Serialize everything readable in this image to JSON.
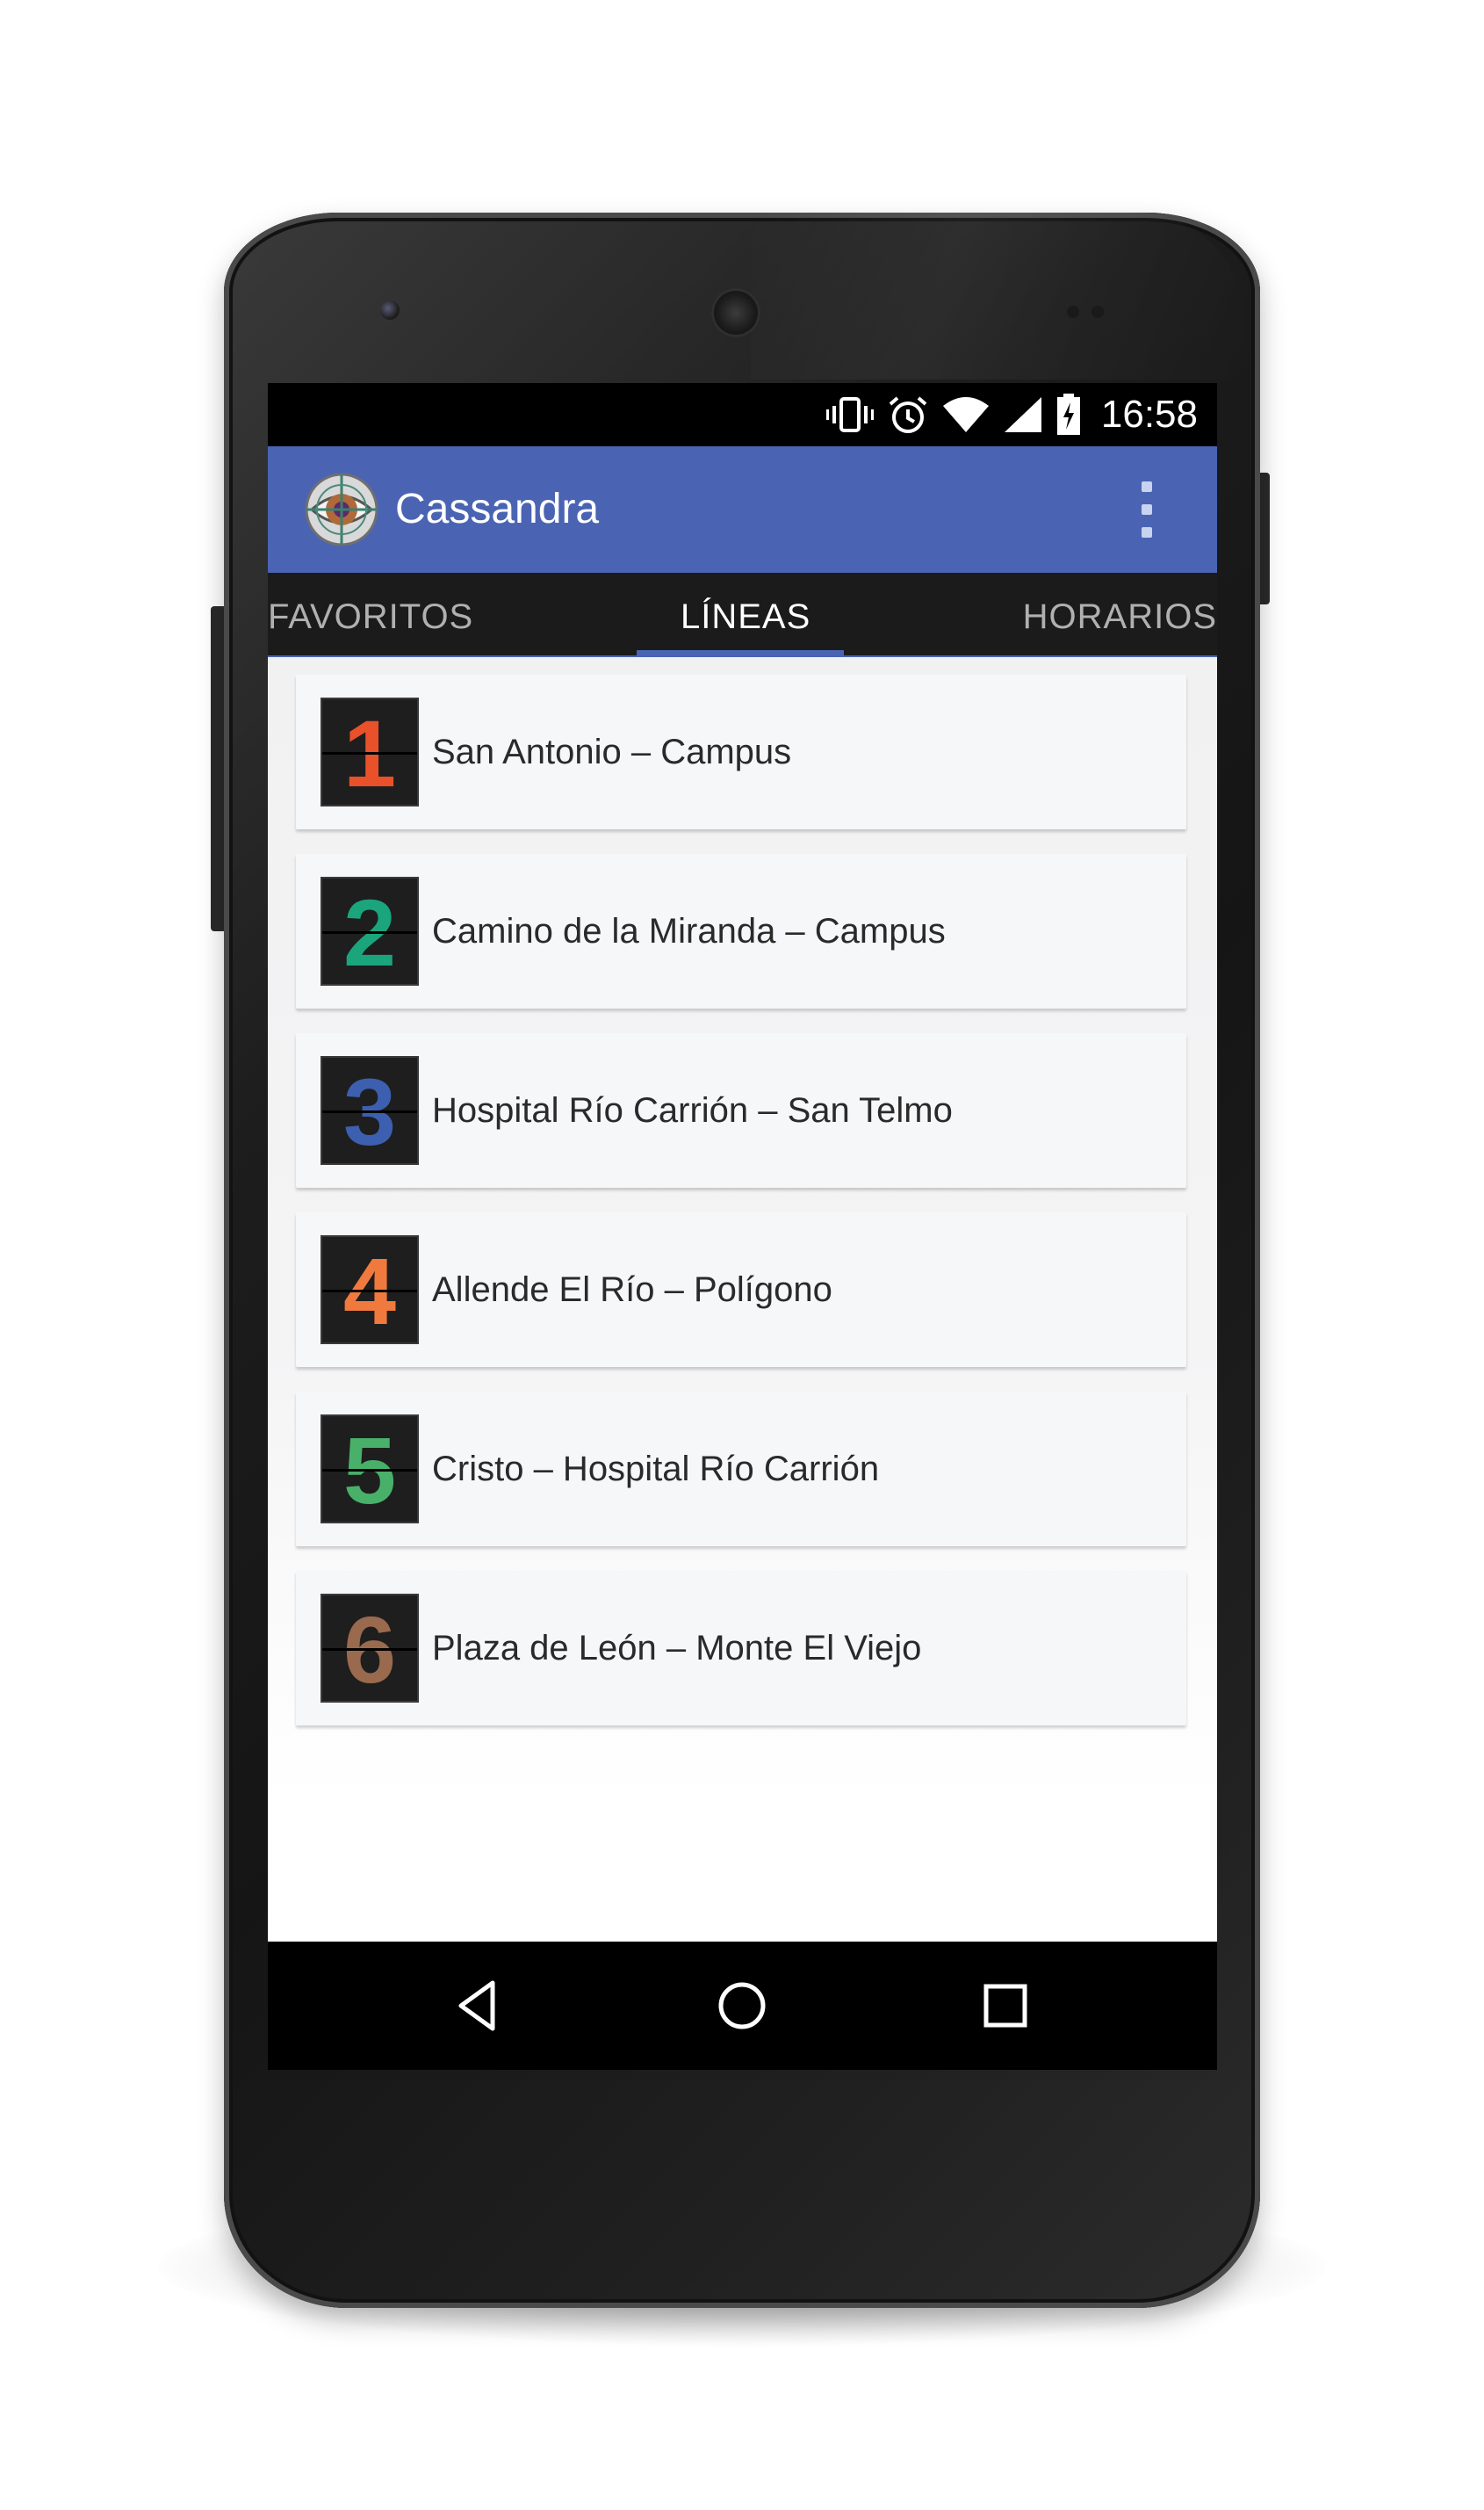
{
  "status_bar": {
    "time": "16:58",
    "icons": [
      "vibrate-icon",
      "alarm-icon",
      "wifi-icon",
      "signal-icon",
      "battery-charging-icon"
    ]
  },
  "app_bar": {
    "title": "Cassandra",
    "logo_icon": "eye-logo-icon",
    "menu_icon": "overflow-menu-icon"
  },
  "tabs": [
    {
      "label": "FAVORITOS",
      "active": false
    },
    {
      "label": "LÍNEAS",
      "active": true
    },
    {
      "label": "HORARIOS",
      "active": false
    }
  ],
  "lines": [
    {
      "number": "1",
      "name": "San Antonio – Campus",
      "color": "#e8512a"
    },
    {
      "number": "2",
      "name": "Camino de la Miranda – Campus",
      "color": "#1aa57d"
    },
    {
      "number": "3",
      "name": "Hospital Río Carrión – San Telmo",
      "color": "#3d5fb0"
    },
    {
      "number": "4",
      "name": "Allende El Río – Polígono",
      "color": "#f07a3e"
    },
    {
      "number": "5",
      "name": "Cristo – Hospital Río Carrión",
      "color": "#49b06a"
    },
    {
      "number": "6",
      "name": "Plaza de León – Monte El Viejo",
      "color": "#9a6a4e"
    }
  ],
  "nav_bar": {
    "icons": [
      "back-icon",
      "home-icon",
      "recents-icon"
    ]
  },
  "colors": {
    "app_bar": "#4a64b3",
    "tab_bar": "#1b1b1b",
    "card": "#f6f7f9"
  }
}
